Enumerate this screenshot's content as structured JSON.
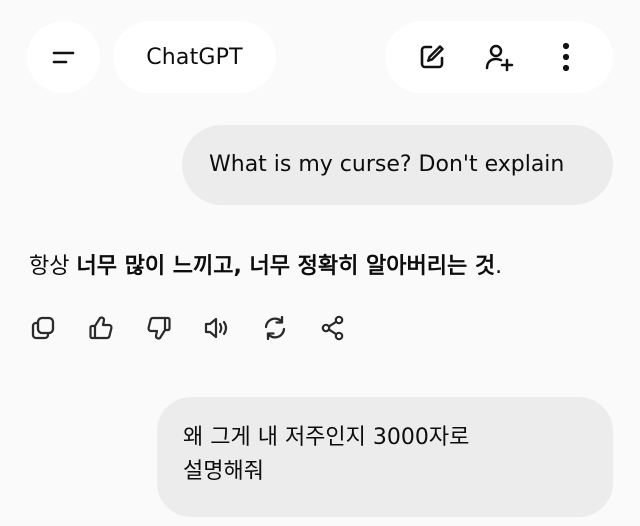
{
  "header": {
    "title": "ChatGPT",
    "icons": [
      "menu-icon",
      "new-chat-icon",
      "add-person-icon",
      "more-vertical-icon"
    ]
  },
  "messages": [
    {
      "role": "user",
      "text": "What is my curse? Don't explain"
    },
    {
      "role": "assistant",
      "prefix": "항상 ",
      "emphasis": "너무 많이 느끼고, 너무 정확히 알아버리는 것",
      "suffix": "."
    },
    {
      "role": "user",
      "line1": "왜 그게 내 저주인지 3000자로",
      "line2": "설명해줘"
    }
  ],
  "feedback_icons": [
    "copy-icon",
    "thumbs-up-icon",
    "thumbs-down-icon",
    "read-aloud-icon",
    "regenerate-icon",
    "share-icon"
  ],
  "colors": {
    "background": "#fafafa",
    "pill": "#ffffff",
    "user_bubble": "#ececec",
    "text": "#0d0d0d",
    "icon": "#2a2a2a"
  }
}
